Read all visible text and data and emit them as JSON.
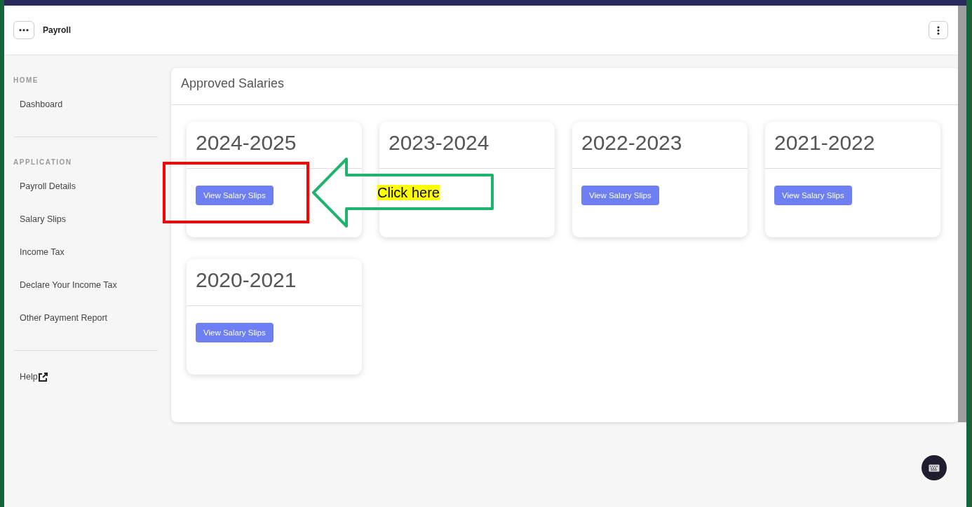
{
  "header": {
    "title": "Payroll"
  },
  "sidebar": {
    "sections": [
      {
        "heading": "HOME",
        "items": [
          {
            "label": "Dashboard",
            "kind": "link"
          }
        ]
      },
      {
        "heading": "APPLICATION",
        "items": [
          {
            "label": "Payroll Details",
            "kind": "link"
          },
          {
            "label": "Salary Slips",
            "kind": "link"
          },
          {
            "label": "Income Tax",
            "kind": "link"
          },
          {
            "label": "Declare Your Income Tax",
            "kind": "link"
          },
          {
            "label": "Other Payment Report",
            "kind": "link"
          }
        ]
      },
      {
        "items": [
          {
            "label": "Help",
            "kind": "external"
          }
        ]
      }
    ]
  },
  "panel": {
    "title": "Approved Salaries",
    "cards": [
      {
        "year": "2024-2025",
        "button": "View Salary Slips"
      },
      {
        "year": "2023-2024"
      },
      {
        "year": "2022-2023",
        "button": "View Salary Slips"
      },
      {
        "year": "2021-2022",
        "button": "View Salary Slips"
      },
      {
        "year": "2020-2021",
        "button": "View Salary Slips"
      }
    ]
  },
  "annotation": {
    "callout": "Click here"
  }
}
